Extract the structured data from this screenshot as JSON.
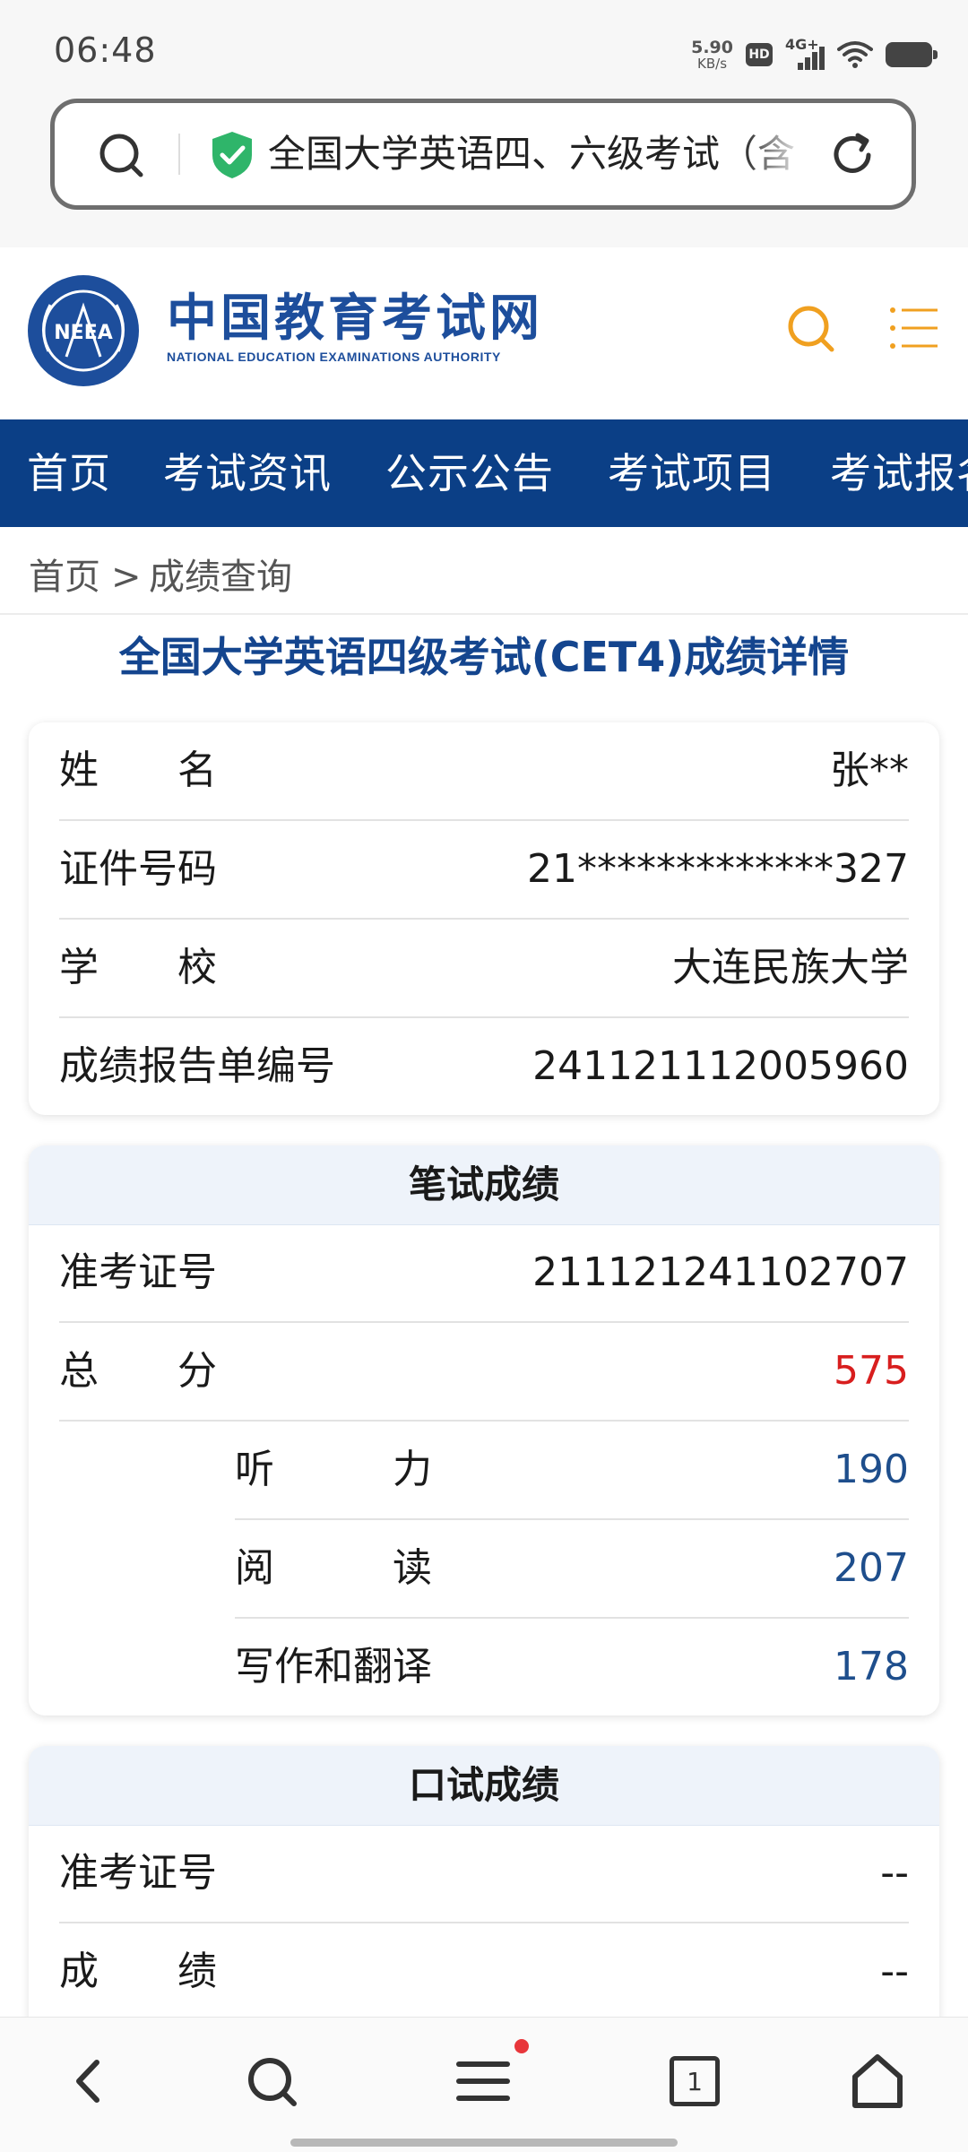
{
  "status_bar": {
    "time": "06:48",
    "net_speed": "5.90",
    "net_speed_unit": "KB/s",
    "hd": "HD",
    "network": "4G+"
  },
  "browser": {
    "url_text": "全国大学英语四、六级考试（含"
  },
  "site": {
    "name_cn": "中国教育考试网",
    "name_en": "NATIONAL EDUCATION EXAMINATIONS AUTHORITY",
    "logo_text": "NEEA"
  },
  "nav": {
    "items": [
      "首页",
      "考试资讯",
      "公示公告",
      "考试项目",
      "考试报名"
    ]
  },
  "breadcrumb": {
    "home": "首页",
    "separator": ">",
    "current": "成绩查询"
  },
  "page_title": "全国大学英语四级考试(CET4)成绩详情",
  "personal_info": {
    "rows": [
      {
        "label": "姓　　名",
        "value": "张**"
      },
      {
        "label": "证件号码",
        "value": "21*************327"
      },
      {
        "label": "学　　校",
        "value": "大连民族大学"
      },
      {
        "label": "成绩报告单编号",
        "value": "241121112005960"
      }
    ]
  },
  "written": {
    "title": "笔试成绩",
    "admission_label": "准考证号",
    "admission_value": "211121241102707",
    "total_label": "总　　分",
    "total_value": "575",
    "sub_scores": [
      {
        "label": "听　　　力",
        "value": "190"
      },
      {
        "label": "阅　　　读",
        "value": "207"
      },
      {
        "label": "写作和翻译",
        "value": "178"
      }
    ]
  },
  "oral": {
    "title": "口试成绩",
    "admission_label": "准考证号",
    "admission_value": "--",
    "score_label": "成　　绩",
    "score_value": "--"
  },
  "bottom_nav": {
    "tab_count": "1"
  },
  "colors": {
    "nav_bg": "#0b3f86",
    "brand_blue": "#1d4e9c",
    "accent_orange": "#f0a020",
    "score_red": "#d81e1e",
    "score_blue": "#1e4e8c",
    "secure_green": "#2fb56a"
  }
}
